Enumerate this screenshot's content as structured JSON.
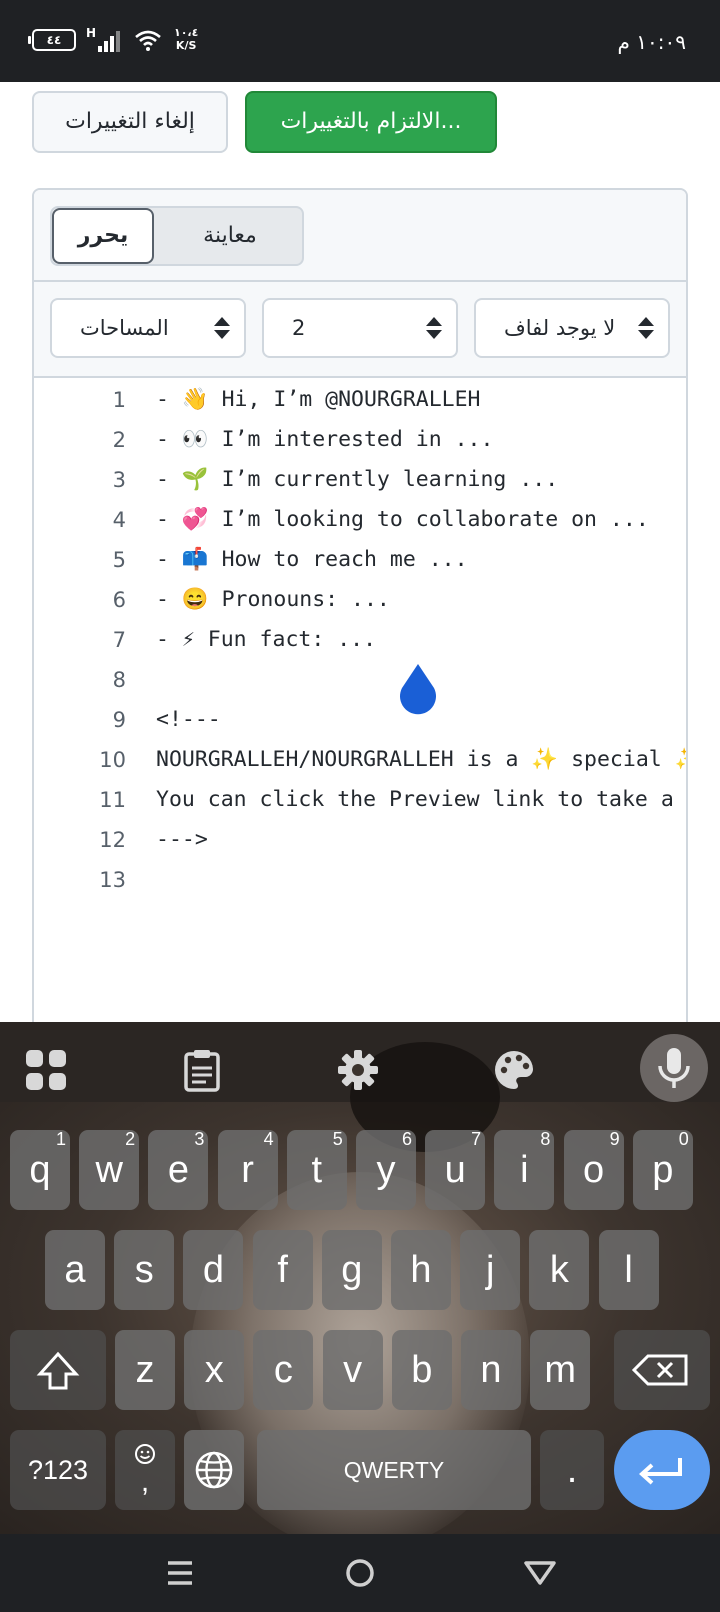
{
  "status_bar": {
    "battery": "٤٤",
    "network": "H",
    "speed_value": "١٠،٤",
    "speed_unit": "K/S",
    "time": "١٠:٠٩ م"
  },
  "actions": {
    "cancel_label": "إلغاء التغييرات",
    "commit_label": "الالتزام بالتغييرات..."
  },
  "editor": {
    "tabs": {
      "edit": "يحرر",
      "preview": "معاينة"
    },
    "indent_mode": "المساحات",
    "indent_size": "2",
    "wrap_mode": "لا يوجد لفاف",
    "lines": [
      {
        "n": "1",
        "text": "- 👋 Hi, I’m @NOURGRALLEH"
      },
      {
        "n": "2",
        "text": "- 👀 I’m interested in ..."
      },
      {
        "n": "3",
        "text": "- 🌱 I’m currently learning ..."
      },
      {
        "n": "4",
        "text": "- 💞️ I’m looking to collaborate on ..."
      },
      {
        "n": "5",
        "text": "- 📫 How to reach me ..."
      },
      {
        "n": "6",
        "text": "- 😄 Pronouns: ..."
      },
      {
        "n": "7",
        "text": "- ⚡ Fun fact: ..."
      },
      {
        "n": "8",
        "text": ""
      },
      {
        "n": "9",
        "text": "<!---"
      },
      {
        "n": "10",
        "text": "NOURGRALLEH/NOURGRALLEH is a ✨ special ✨ repository because its README.md"
      },
      {
        "n": "11",
        "text": "You can click the Preview link to take a look at your changes."
      },
      {
        "n": "12",
        "text": "--->"
      },
      {
        "n": "13",
        "text": ""
      }
    ]
  },
  "keyboard": {
    "row1": [
      {
        "k": "q",
        "sup": "1"
      },
      {
        "k": "w",
        "sup": "2"
      },
      {
        "k": "e",
        "sup": "3"
      },
      {
        "k": "r",
        "sup": "4"
      },
      {
        "k": "t",
        "sup": "5"
      },
      {
        "k": "y",
        "sup": "6"
      },
      {
        "k": "u",
        "sup": "7"
      },
      {
        "k": "i",
        "sup": "8"
      },
      {
        "k": "o",
        "sup": "9"
      },
      {
        "k": "p",
        "sup": "0"
      }
    ],
    "row2": [
      "a",
      "s",
      "d",
      "f",
      "g",
      "h",
      "j",
      "k",
      "l"
    ],
    "row3": [
      "z",
      "x",
      "c",
      "v",
      "b",
      "n",
      "m"
    ],
    "symbols_label": "?123",
    "comma_label": ",",
    "space_label": "QWERTY",
    "period_label": "."
  }
}
